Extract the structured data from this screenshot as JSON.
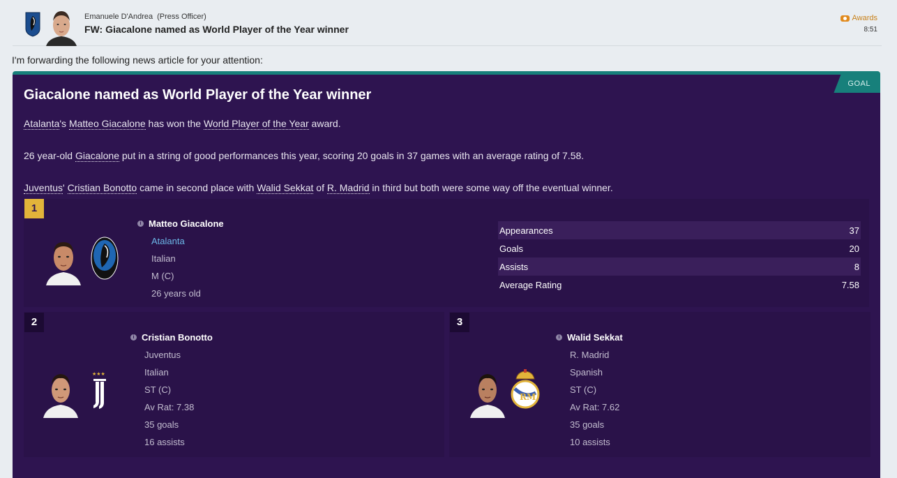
{
  "header": {
    "sender_name": "Emanuele D'Andrea",
    "sender_role": "(Press Officer)",
    "subject": "FW: Giacalone named as World Player of the Year winner",
    "tag_label": "Awards",
    "time": "8:51"
  },
  "intro": "I'm forwarding the following news article for your attention:",
  "article": {
    "tag": "GOAL",
    "headline": "Giacalone named as World Player of the Year winner",
    "p1": {
      "club": "Atalanta",
      "possessive": "'s ",
      "player": "Matteo Giacalone",
      "mid": " has won the ",
      "award": "World Player of the Year",
      "end": " award."
    },
    "p2": {
      "pre": "26 year-old ",
      "player": "Giacalone",
      "post": " put in a string of good performances this year, scoring 20 goals in 37 games with an average rating of 7.58."
    },
    "p3": {
      "club1": "Juventus",
      "apos": "' ",
      "player1": "Cristian Bonotto",
      "mid1": " came in second place with ",
      "player2": "Walid Sekkat",
      "of": " of ",
      "club2": "R. Madrid",
      "end": " in third but both were some way off the eventual winner."
    }
  },
  "winner": {
    "rank": "1",
    "name": "Matteo Giacalone",
    "club": "Atalanta",
    "nationality": "Italian",
    "position": "M (C)",
    "age": "26 years old",
    "stats": [
      {
        "label": "Appearances",
        "value": "37"
      },
      {
        "label": "Goals",
        "value": "20"
      },
      {
        "label": "Assists",
        "value": "8"
      },
      {
        "label": "Average Rating",
        "value": "7.58"
      }
    ]
  },
  "second": {
    "rank": "2",
    "name": "Cristian Bonotto",
    "club": "Juventus",
    "nationality": "Italian",
    "position": "ST (C)",
    "rating": "Av Rat: 7.38",
    "goals": "35 goals",
    "assists": "16 assists"
  },
  "third": {
    "rank": "3",
    "name": "Walid Sekkat",
    "club": "R. Madrid",
    "nationality": "Spanish",
    "position": "ST (C)",
    "rating": "Av Rat: 7.62",
    "goals": "35 goals",
    "assists": "10 assists"
  },
  "colors": {
    "article_bg": "#2e1450",
    "accent_teal": "#17807b",
    "gold": "#e2b43a",
    "link_blue": "#6cb7e8",
    "awards_orange": "#c8811a"
  }
}
